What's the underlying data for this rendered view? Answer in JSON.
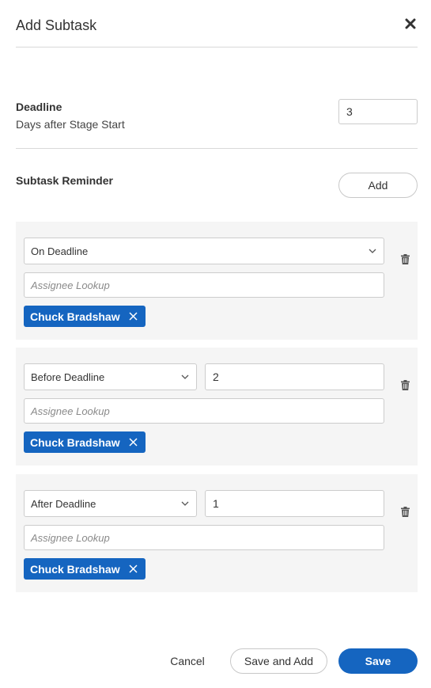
{
  "dialog": {
    "title": "Add Subtask"
  },
  "deadline": {
    "label": "Deadline",
    "sublabel": "Days after Stage Start",
    "value": "3"
  },
  "reminders": {
    "label": "Subtask Reminder",
    "add_label": "Add",
    "items": [
      {
        "timing": "On Deadline",
        "days": "",
        "assignee_placeholder": "Assignee Lookup",
        "assignee_chip": "Chuck Bradshaw"
      },
      {
        "timing": "Before Deadline",
        "days": "2",
        "assignee_placeholder": "Assignee Lookup",
        "assignee_chip": "Chuck Bradshaw"
      },
      {
        "timing": "After Deadline",
        "days": "1",
        "assignee_placeholder": "Assignee Lookup",
        "assignee_chip": "Chuck Bradshaw"
      }
    ]
  },
  "footer": {
    "cancel_label": "Cancel",
    "save_and_add_label": "Save and Add",
    "save_label": "Save"
  },
  "colors": {
    "primary": "#1565c0",
    "card_background": "#f5f5f5",
    "divider": "#d9d9d9"
  },
  "icons": {
    "close": "close-icon",
    "chevron": "chevron-down-icon",
    "trash": "trash-icon",
    "chip_remove": "close-icon"
  }
}
